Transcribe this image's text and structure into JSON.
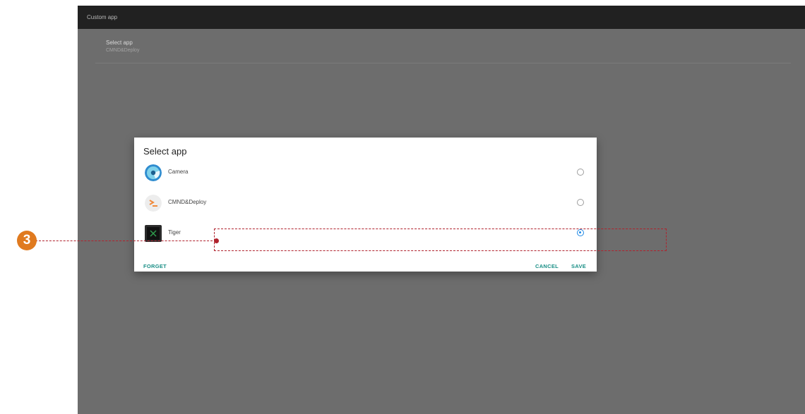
{
  "window": {
    "title": "Custom app"
  },
  "setting": {
    "title": "Select app",
    "value": "CMND&Deploy"
  },
  "dialog": {
    "title": "Select app",
    "apps": [
      {
        "label": "Camera",
        "icon": "camera-icon",
        "selected": false
      },
      {
        "label": "CMND&Deploy",
        "icon": "terminal-icon",
        "selected": false
      },
      {
        "label": "Tiger",
        "icon": "tiger-icon",
        "selected": true
      }
    ],
    "buttons": {
      "forget": "FORGET",
      "cancel": "CANCEL",
      "save": "SAVE"
    }
  },
  "annotation": {
    "step": "3"
  },
  "colors": {
    "accent": "#1a8f86",
    "radio_selected": "#1e88e5",
    "callout": "#b0222d",
    "badge": "#e07a1f"
  }
}
